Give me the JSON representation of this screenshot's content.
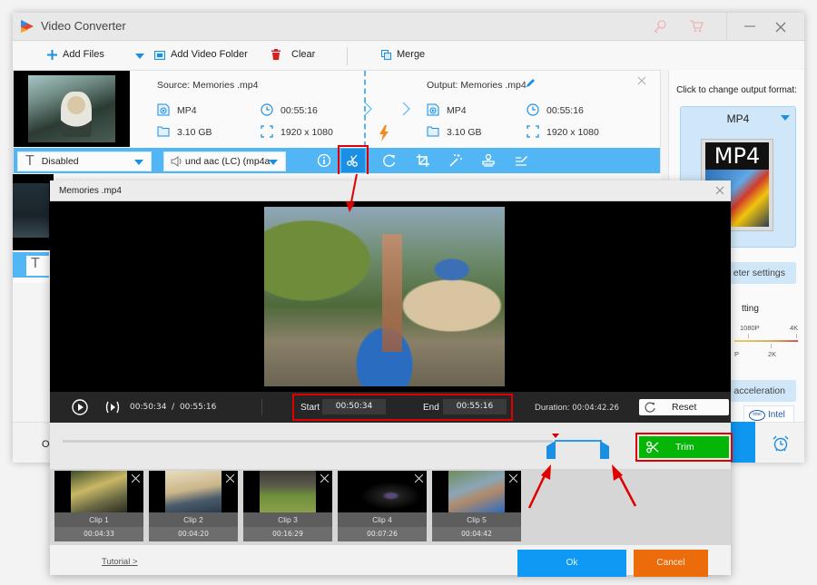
{
  "app": {
    "title": "Video Converter",
    "icons": [
      "logo-icon",
      "key-icon",
      "cart-icon",
      "minimize-icon",
      "close-icon"
    ]
  },
  "toolbar": {
    "add_files": "Add Files",
    "add_video_folder": "Add Video Folder",
    "clear": "Clear",
    "merge": "Merge"
  },
  "file_item": {
    "source": {
      "label": "Source: Memories .mp4",
      "format": "MP4",
      "duration": "00:55:16",
      "size": "3.10 GB",
      "resolution": "1920 x 1080"
    },
    "output": {
      "label": "Output: Memories .mp4",
      "format": "MP4",
      "duration": "00:55:16",
      "size": "3.10 GB",
      "resolution": "1920 x 1080"
    },
    "subtitle_select": "Disabled",
    "audio_select": "und aac (LC) (mp4a",
    "edit_tools": [
      "info-icon",
      "scissors-icon",
      "rotate-icon",
      "crop-icon",
      "effects-icon",
      "watermark-icon",
      "subtitle-edit-icon"
    ]
  },
  "right_panel": {
    "caption": "Click to change output format:",
    "format": "MP4",
    "format_card_label": "MP4",
    "parameter_settings": "eter settings",
    "quality_setting": "tting",
    "quality_ticks_top": [
      "1080P",
      "4K"
    ],
    "quality_ticks_bottom": [
      "P",
      "2K"
    ],
    "hw_accel": "are acceleration",
    "intel": "Intel",
    "intel_logo": "intel"
  },
  "bottom": {
    "output_label_fragment": "O"
  },
  "trim_dialog": {
    "title": "Memories .mp4",
    "current_time": "00:50:34",
    "total_time": "00:55:16",
    "time_separator": "/",
    "start_label": "Start",
    "start_value": "00:50:34",
    "end_label": "End",
    "end_value": "00:55:16",
    "duration_label": "Duration:",
    "duration_value": "00:04:42.26",
    "reset": "Reset",
    "trim": "Trim",
    "selection": {
      "start_fraction": 0.915,
      "end_fraction": 1.0
    },
    "clips": [
      {
        "name": "Clip 1",
        "duration": "00:04:33"
      },
      {
        "name": "Clip 2",
        "duration": "00:04:20"
      },
      {
        "name": "Clip 3",
        "duration": "00:16:29"
      },
      {
        "name": "Clip 4",
        "duration": "00:07:26"
      },
      {
        "name": "Clip 5",
        "duration": "00:04:42"
      }
    ],
    "tutorial": "Tutorial >",
    "ok": "Ok",
    "cancel": "Cancel"
  },
  "colors": {
    "accent_blue": "#1a8fe3",
    "bar_blue": "#52b6f4",
    "trim_green": "#06b606",
    "ok_blue": "#0e9af4",
    "cancel_orange": "#ec6b0a",
    "highlight_red": "#e00000"
  }
}
